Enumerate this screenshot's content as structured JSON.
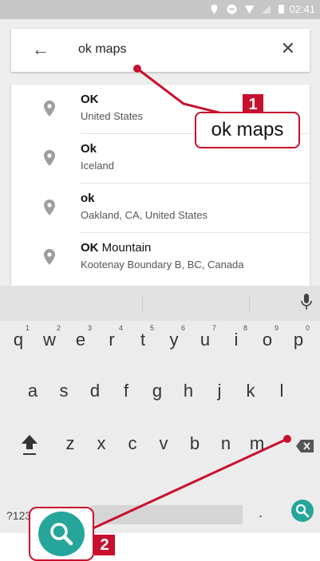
{
  "status_bar": {
    "time": "02:41"
  },
  "search": {
    "query": "ok maps",
    "back_icon": "arrow-left-icon",
    "clear_icon": "close-icon"
  },
  "results": [
    {
      "match": "OK",
      "rest": "",
      "address": "United States"
    },
    {
      "match": "Ok",
      "rest": "",
      "address": "Iceland"
    },
    {
      "match": "ok",
      "rest": "",
      "address": "Oakland, CA, United States"
    },
    {
      "match": "OK",
      "rest": " Mountain",
      "address": "Kootenay Boundary B, BC, Canada"
    }
  ],
  "keyboard": {
    "row1": [
      "q",
      "w",
      "e",
      "r",
      "t",
      "y",
      "u",
      "i",
      "o",
      "p"
    ],
    "row1_numbers": [
      "1",
      "2",
      "3",
      "4",
      "5",
      "6",
      "7",
      "8",
      "9",
      "0"
    ],
    "row2": [
      "a",
      "s",
      "d",
      "f",
      "g",
      "h",
      "j",
      "k",
      "l"
    ],
    "row3": [
      "z",
      "x",
      "c",
      "v",
      "b",
      "n",
      "m"
    ],
    "symbols_key": "?123",
    "comma_key": ",",
    "period_key": "."
  },
  "annotations": {
    "callout1_text": "ok maps",
    "badge1": "1",
    "badge2": "2",
    "accent_color": "#c8102e",
    "search_button_color": "#26a69a"
  }
}
